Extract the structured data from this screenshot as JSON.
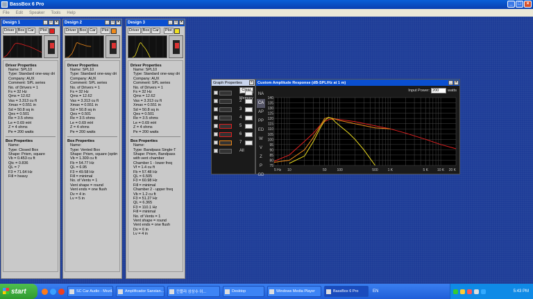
{
  "app": {
    "title": "BassBox 6 Pro",
    "menu": [
      "File",
      "Edit",
      "Speaker",
      "Tools",
      "Help"
    ]
  },
  "designs": [
    {
      "title": "Design 1",
      "toolbar": {
        "driver": "Driver",
        "box": "Box",
        "car": "Car",
        "plot": "Plot"
      },
      "color": "#e02020",
      "driver_header": "Driver Properties",
      "driver_lines": [
        "Name: SPL10",
        "Type: Standard one-way dri",
        "Company: AUX",
        "Comment: SPL series",
        "No. of Drivers = 1",
        "Fs = 32 Hz",
        "Qms = 12.62",
        "Vas = 3.313 cu ft",
        "Xmax = 0.551 in",
        "Sd = 50.8 sq in",
        "Qes = 0.501",
        "Re = 3.5 ohms",
        "Le = 0.69 mH",
        "Z = 4 ohms",
        "Pe = 200 watts"
      ],
      "box_header": "Box Properties",
      "box_lines": [
        "Name:",
        "Type: Closed Box",
        "Shape: Prism, square",
        "Vb = 0.453 cu ft",
        "Qtc = 0.836",
        "QL = 7",
        "F3 = 71.64 Hz",
        "Fill = heavy"
      ]
    },
    {
      "title": "Design 2",
      "toolbar": {
        "driver": "Driver",
        "box": "Box",
        "car": "Car",
        "plot": "Plot"
      },
      "color": "#f08a1a",
      "driver_header": "Driver Properties",
      "driver_lines": [
        "Name: SPL10",
        "Type: Standard one-way dri",
        "Company: AUX",
        "Comment: SPL series",
        "No. of Drivers = 1",
        "Fs = 32 Hz",
        "Qms = 12.62",
        "Vas = 3.313 cu ft",
        "Xmax = 0.551 in",
        "Sd = 50.8 sq in",
        "Qes = 0.501",
        "Re = 3.5 ohms",
        "Le = 0.69 mH",
        "Z = 4 ohms",
        "Pe = 200 watts"
      ],
      "box_header": "Box Properties",
      "box_lines": [
        "Name:",
        "Type: Vented Box",
        "Shape: Prism, square (optim",
        "Vb = 1.309 cu ft",
        "Fb = 54.77 Hz",
        "QL = 6.95",
        "F3 = 49.58 Hz",
        "Fill = minimal",
        "No. of Vents = 1",
        "Vent shape = round",
        "Vent ends = one flush",
        "Dv = 4 in",
        "Lv = 5 in"
      ]
    },
    {
      "title": "Design 3",
      "toolbar": {
        "driver": "Driver",
        "box": "Box",
        "car": "Car",
        "plot": "Plot"
      },
      "color": "#f0e020",
      "driver_header": "Driver Properties",
      "driver_lines": [
        "Name: SPL10",
        "Type: Standard one-way dri",
        "Company: AUX",
        "Comment: SPL series",
        "No. of Drivers = 1",
        "Fs = 32 Hz",
        "Qms = 12.62",
        "Vas = 3.313 cu ft",
        "Xmax = 0.551 in",
        "Sd = 50.8 sq in",
        "Qes = 0.501",
        "Re = 3.5 ohms",
        "Le = 0.69 mH",
        "Z = 4 ohms",
        "Pe = 200 watts"
      ],
      "box_header": "Box Properties",
      "box_lines": [
        "Name:",
        "Type: Bandpass Single-T",
        "Shape: Prism, Bandpass",
        "with vent chamber",
        "Chamber 1 - lower freq",
        "Vf = 1.4 cu ft",
        "Fb = 57.48 Hz",
        "QL = 6.505",
        "F3 = 60.98 Hz",
        "Fill = minimal",
        "Chamber 2 - upper freq",
        "Vb = 1.2 cu ft",
        "F3 = 51.27 Hz",
        "QL = 6.365",
        "F3 = 110.1 Hz",
        "Fill = minimal",
        "No. of Vents = 1",
        "Vent shape = round",
        "Vent ends = one flush",
        "Dv = 6 in",
        "Lv = 4 in"
      ]
    }
  ],
  "graph_props": {
    "title": "Graph Properties",
    "clear": "Clear",
    "memory": "Memory",
    "rows": [
      "1",
      "2",
      "3",
      "4",
      "5",
      "6",
      "7",
      "All"
    ]
  },
  "amplitude": {
    "title": "Custom Amplitude Response (dB-SPL/Hz at 1 m)",
    "input_power_label": "Input Power:",
    "input_power_value": "200",
    "input_power_unit": "watts",
    "side_buttons": [
      "NA",
      "CA",
      "AP",
      "PP",
      "ED",
      "W",
      "V",
      "Z",
      "P",
      "GD"
    ],
    "y_ticks": [
      "140",
      "135",
      "130",
      "125",
      "120",
      "115",
      "110",
      "105",
      "100",
      "95",
      "90",
      "85",
      "80",
      "75"
    ],
    "x_ticks": [
      "5 Hz",
      "10",
      "50",
      "100",
      "500",
      "1 K",
      "5 K",
      "10 K",
      "20 K"
    ]
  },
  "chart_data": {
    "type": "line",
    "title": "Custom Amplitude Response (dB-SPL/Hz at 1 m)",
    "xscale": "log",
    "xlim": [
      5,
      20000
    ],
    "ylim": [
      75,
      140
    ],
    "series": [
      {
        "color": "#e02020",
        "x": [
          5,
          10,
          20,
          30,
          40,
          50,
          60,
          80,
          100,
          200,
          500,
          1000,
          2000,
          5000,
          10000,
          20000
        ],
        "y": [
          79,
          85,
          98,
          106,
          113,
          117,
          119,
          119.5,
          119,
          117,
          113,
          110,
          106,
          100,
          95,
          91
        ]
      },
      {
        "color": "#f08a1a",
        "x": [
          5,
          10,
          20,
          30,
          40,
          50,
          60,
          80,
          100,
          200,
          500,
          1000
        ],
        "y": [
          78,
          80,
          90,
          102,
          112,
          120,
          121,
          119.5,
          118,
          115,
          111,
          110
        ]
      },
      {
        "color": "#f0e020",
        "x": [
          10,
          20,
          30,
          40,
          50,
          60,
          70,
          80,
          100,
          150,
          200,
          300,
          500
        ],
        "y": [
          77,
          84,
          98,
          110,
          118,
          121,
          120,
          117,
          113,
          106,
          100,
          90,
          75
        ]
      }
    ]
  },
  "taskbar": {
    "start": "start",
    "tasks": [
      "SC Car Audio - Mozil...",
      "Amplificador Sanxian...",
      "칸플라 상상수 이...",
      "Desktop",
      "Windows Media Player",
      "BassBox 6 Pro"
    ],
    "lang": "EN",
    "clock": "5:43 PM"
  }
}
